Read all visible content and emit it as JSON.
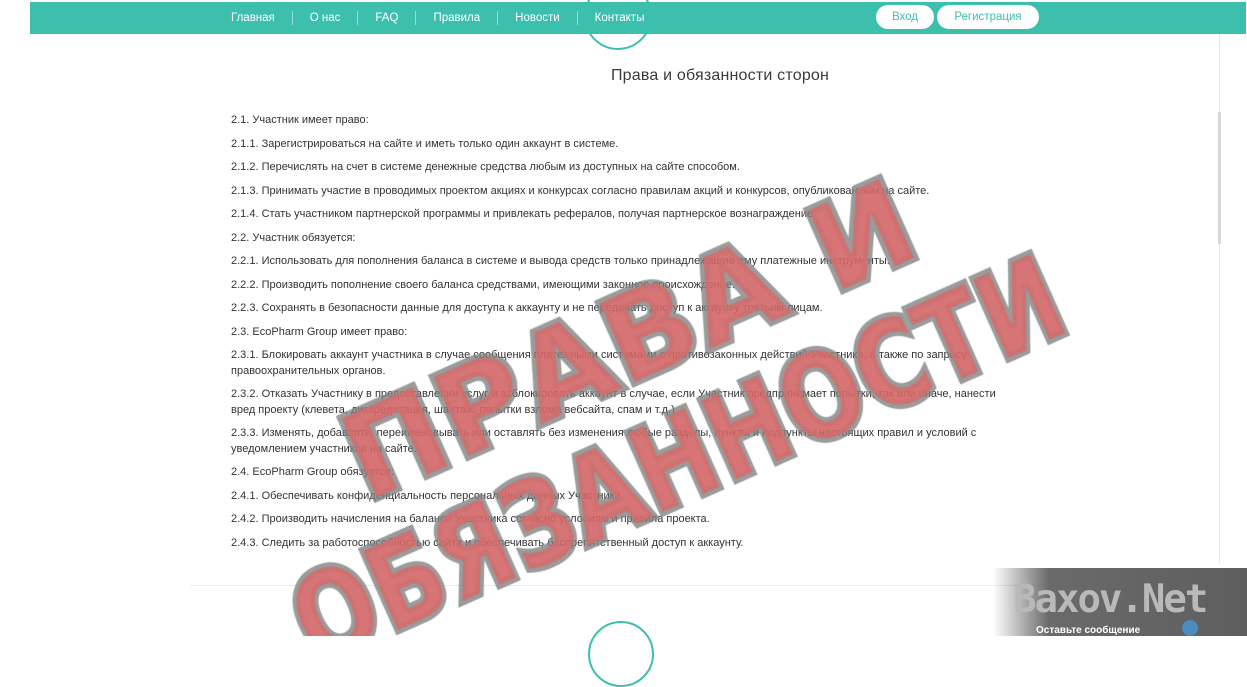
{
  "nav": {
    "items": [
      "Главная",
      "О нас",
      "FAQ",
      "Правила",
      "Новости",
      "Контакты"
    ],
    "login": "Вход",
    "register": "Регистрация"
  },
  "page": {
    "title": "Права и обязанности сторон",
    "paragraphs": [
      "2.1. Участник имеет право:",
      "2.1.1. Зарегистрироваться на сайте и иметь только один аккаунт в системе.",
      "2.1.2. Перечислять на счет в системе денежные средства любым из доступных на сайте способом.",
      "2.1.3. Принимать участие в проводимых проектом акциях и конкурсах согласно правилам акций и конкурсов, опубликованным на сайте.",
      "2.1.4. Стать участником партнерской программы и привлекать рефералов, получая партнерское вознаграждение.",
      "2.2. Участник обязуется:",
      "2.2.1. Использовать для пополнения баланса в системе и вывода средств только принадлежащие ему платежные инструменты.",
      "2.2.2. Производить пополнение своего баланса средствами, имеющими законное происхождение.",
      "2.2.3. Сохранять в безопасности данные для доступа к аккаунту и не передавать доступ к аккаунту третьим лицам.",
      "2.3. EcoPharm Group имеет право:",
      "2.3.1. Блокировать аккаунт участника в случае сообщения платежными системами о противозаконных действий Участника, а также по запросу правоохранительных органов.",
      "2.3.2. Отказать Участнику в предоставлении услуг и заблокировать аккаунт в случае, если Участник предпринимает попытки, так или иначе, нанести вред проекту (клевета, дискредитация, шантаж, попытки взлома вебсайта, спам и т.д.).",
      "2.3.3. Изменять, добавлять, переименовывать или оставлять без изменения любые разделы, пункты и подпункты настоящих правил и условий с уведомлением участников на сайте.",
      "2.4. EcoPharm Group обязуется:",
      "2.4.1. Обеспечивать конфиденциальность персональных данных Участника.",
      "2.4.2. Производить начисления на балансе Участника согласно условиям и правила проекта.",
      "2.4.3. Следить за работоспособностью сайта и обеспечивать беспрепятственный доступ к аккаунту."
    ]
  },
  "stamp": {
    "line1": "ПРАВА И",
    "line2": "ОБЯЗАННОСТИ",
    "color": "#d9534f"
  },
  "watermark": {
    "logo": "Baxov.Net",
    "message": "Оставьте сообщение"
  },
  "colors": {
    "accent": "#3dbfae",
    "stamp_red": "#e0696a"
  }
}
